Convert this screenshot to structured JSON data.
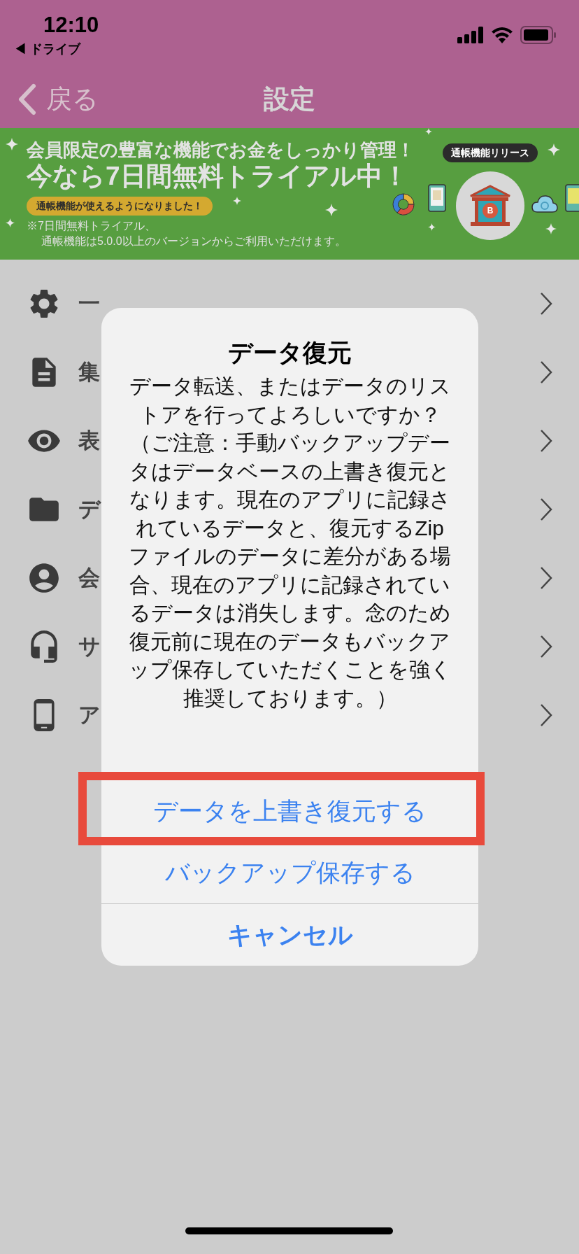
{
  "status_bar": {
    "time": "12:10",
    "back_app": "◀ ドライブ"
  },
  "nav": {
    "back": "戻る",
    "title": "設定"
  },
  "banner": {
    "headline": "会員限定の豊富な機能でお金をしっかり管理！",
    "subheadline": "今なら7日間無料トライアル中！",
    "pill": "通帳機能が使えるようになりました！",
    "notes": [
      "※7日間無料トライアル、",
      "通帳機能は5.0.0以上のバージョンからご利用いただけます。"
    ],
    "badge": "通帳機能リリース",
    "bank_letter": "B"
  },
  "settings": [
    {
      "label": "一"
    },
    {
      "label": "集"
    },
    {
      "label": "表"
    },
    {
      "label": "デ"
    },
    {
      "label": "会"
    },
    {
      "label": "サ"
    },
    {
      "label": "ア"
    }
  ],
  "dialog": {
    "title": "データ復元",
    "message": "データ転送、またはデータのリストアを行ってよろしいですか？（ご注意：手動バックアップデータはデータベースの上書き復元となります。現在のアプリに記録されているデータと、復元するZipファイルのデータに差分がある場合、現在のアプリに記録されているデータは消失します。念のため復元前に現在のデータもバックアップ保存していただくことを強く推奨しております。）",
    "actions": [
      {
        "label": "データを上書き復元する",
        "kind": "action",
        "highlighted": true
      },
      {
        "label": "バックアップ保存する",
        "kind": "action",
        "highlighted": false
      },
      {
        "label": "キャンセル",
        "kind": "cancel",
        "highlighted": false
      }
    ]
  }
}
